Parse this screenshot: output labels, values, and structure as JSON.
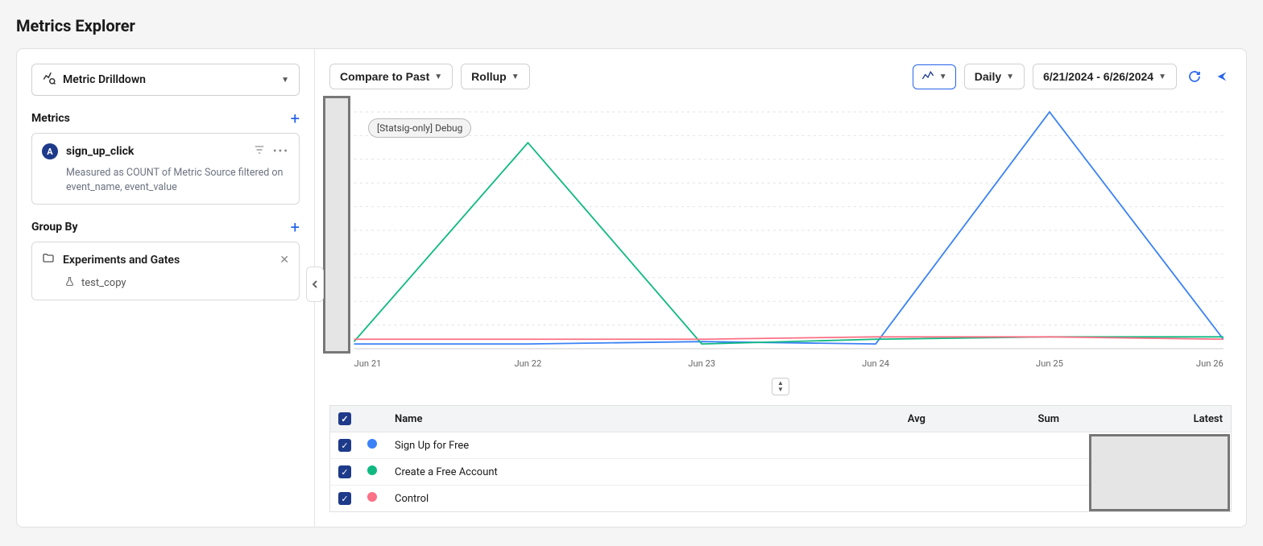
{
  "page": {
    "title": "Metrics Explorer"
  },
  "sidebar": {
    "mode_label": "Metric Drilldown",
    "metrics_section": "Metrics",
    "groupby_section": "Group By",
    "metric": {
      "badge": "A",
      "name": "sign_up_click",
      "description": "Measured as COUNT of Metric Source filtered on event_name, event_value"
    },
    "group": {
      "name": "Experiments and Gates",
      "sub": "test_copy"
    }
  },
  "toolbar": {
    "compare": "Compare to Past",
    "rollup": "Rollup",
    "granularity": "Daily",
    "date_range": "6/21/2024 - 6/26/2024"
  },
  "chart": {
    "debug_label": "[Statsig-only] Debug",
    "x_labels": [
      "Jun 21",
      "Jun 22",
      "Jun 23",
      "Jun 24",
      "Jun 25",
      "Jun 26"
    ]
  },
  "legend": {
    "columns": {
      "name": "Name",
      "avg": "Avg",
      "sum": "Sum",
      "latest": "Latest"
    },
    "rows": [
      {
        "name": "Sign Up for Free",
        "color": "#3b82f6"
      },
      {
        "name": "Create a Free Account",
        "color": "#10b981"
      },
      {
        "name": "Control",
        "color": "#fb7185"
      }
    ]
  },
  "chart_data": {
    "type": "line",
    "title": "",
    "xlabel": "",
    "ylabel": "",
    "categories": [
      "Jun 21",
      "Jun 22",
      "Jun 23",
      "Jun 24",
      "Jun 25",
      "Jun 26"
    ],
    "series": [
      {
        "name": "Sign Up for Free",
        "color": "#3b82f6",
        "values": [
          2,
          2,
          3,
          2,
          100,
          4
        ]
      },
      {
        "name": "Create a Free Account",
        "color": "#10b981",
        "values": [
          3,
          87,
          2,
          4,
          5,
          5
        ]
      },
      {
        "name": "Control",
        "color": "#fb7185",
        "values": [
          4,
          4,
          4,
          5,
          5,
          4
        ]
      }
    ],
    "ylim": [
      0,
      100
    ]
  }
}
